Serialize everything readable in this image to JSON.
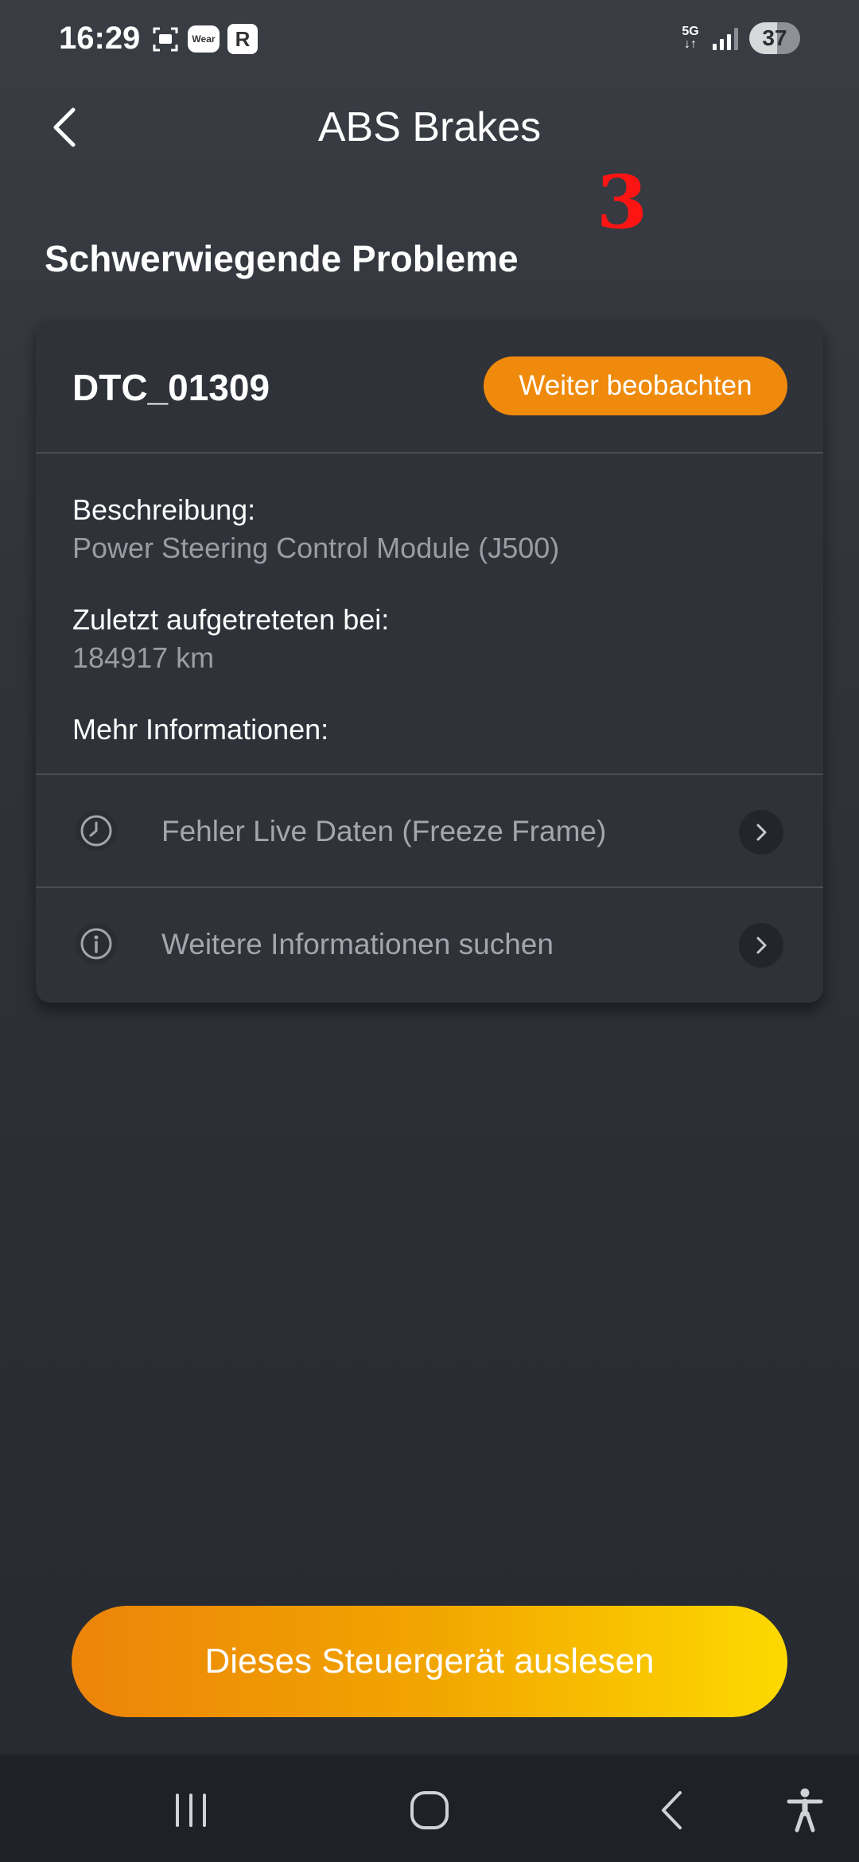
{
  "status_bar": {
    "time": "16:29",
    "wear_label": "Wear",
    "r_label": "R",
    "network": "5G",
    "battery": "37"
  },
  "header": {
    "title": "ABS Brakes",
    "annotation": "3"
  },
  "section_title": "Schwerwiegende Probleme",
  "card": {
    "code": "DTC_01309",
    "watch_button": "Weiter beobachten",
    "description_label": "Beschreibung:",
    "description_value": "Power Steering Control Module (J500)",
    "last_seen_label": "Zuletzt aufgetreteten bei:",
    "last_seen_value": "184917 km",
    "more_info_label": "Mehr Informationen:",
    "rows": [
      {
        "label": "Fehler Live Daten (Freeze Frame)",
        "icon": "clock-icon"
      },
      {
        "label": "Weitere Informationen suchen",
        "icon": "info-icon"
      }
    ]
  },
  "cta": {
    "label": "Dieses Steuergerät auslesen"
  },
  "colors": {
    "accent": "#ef8a0c",
    "annotation": "#ff1414"
  }
}
